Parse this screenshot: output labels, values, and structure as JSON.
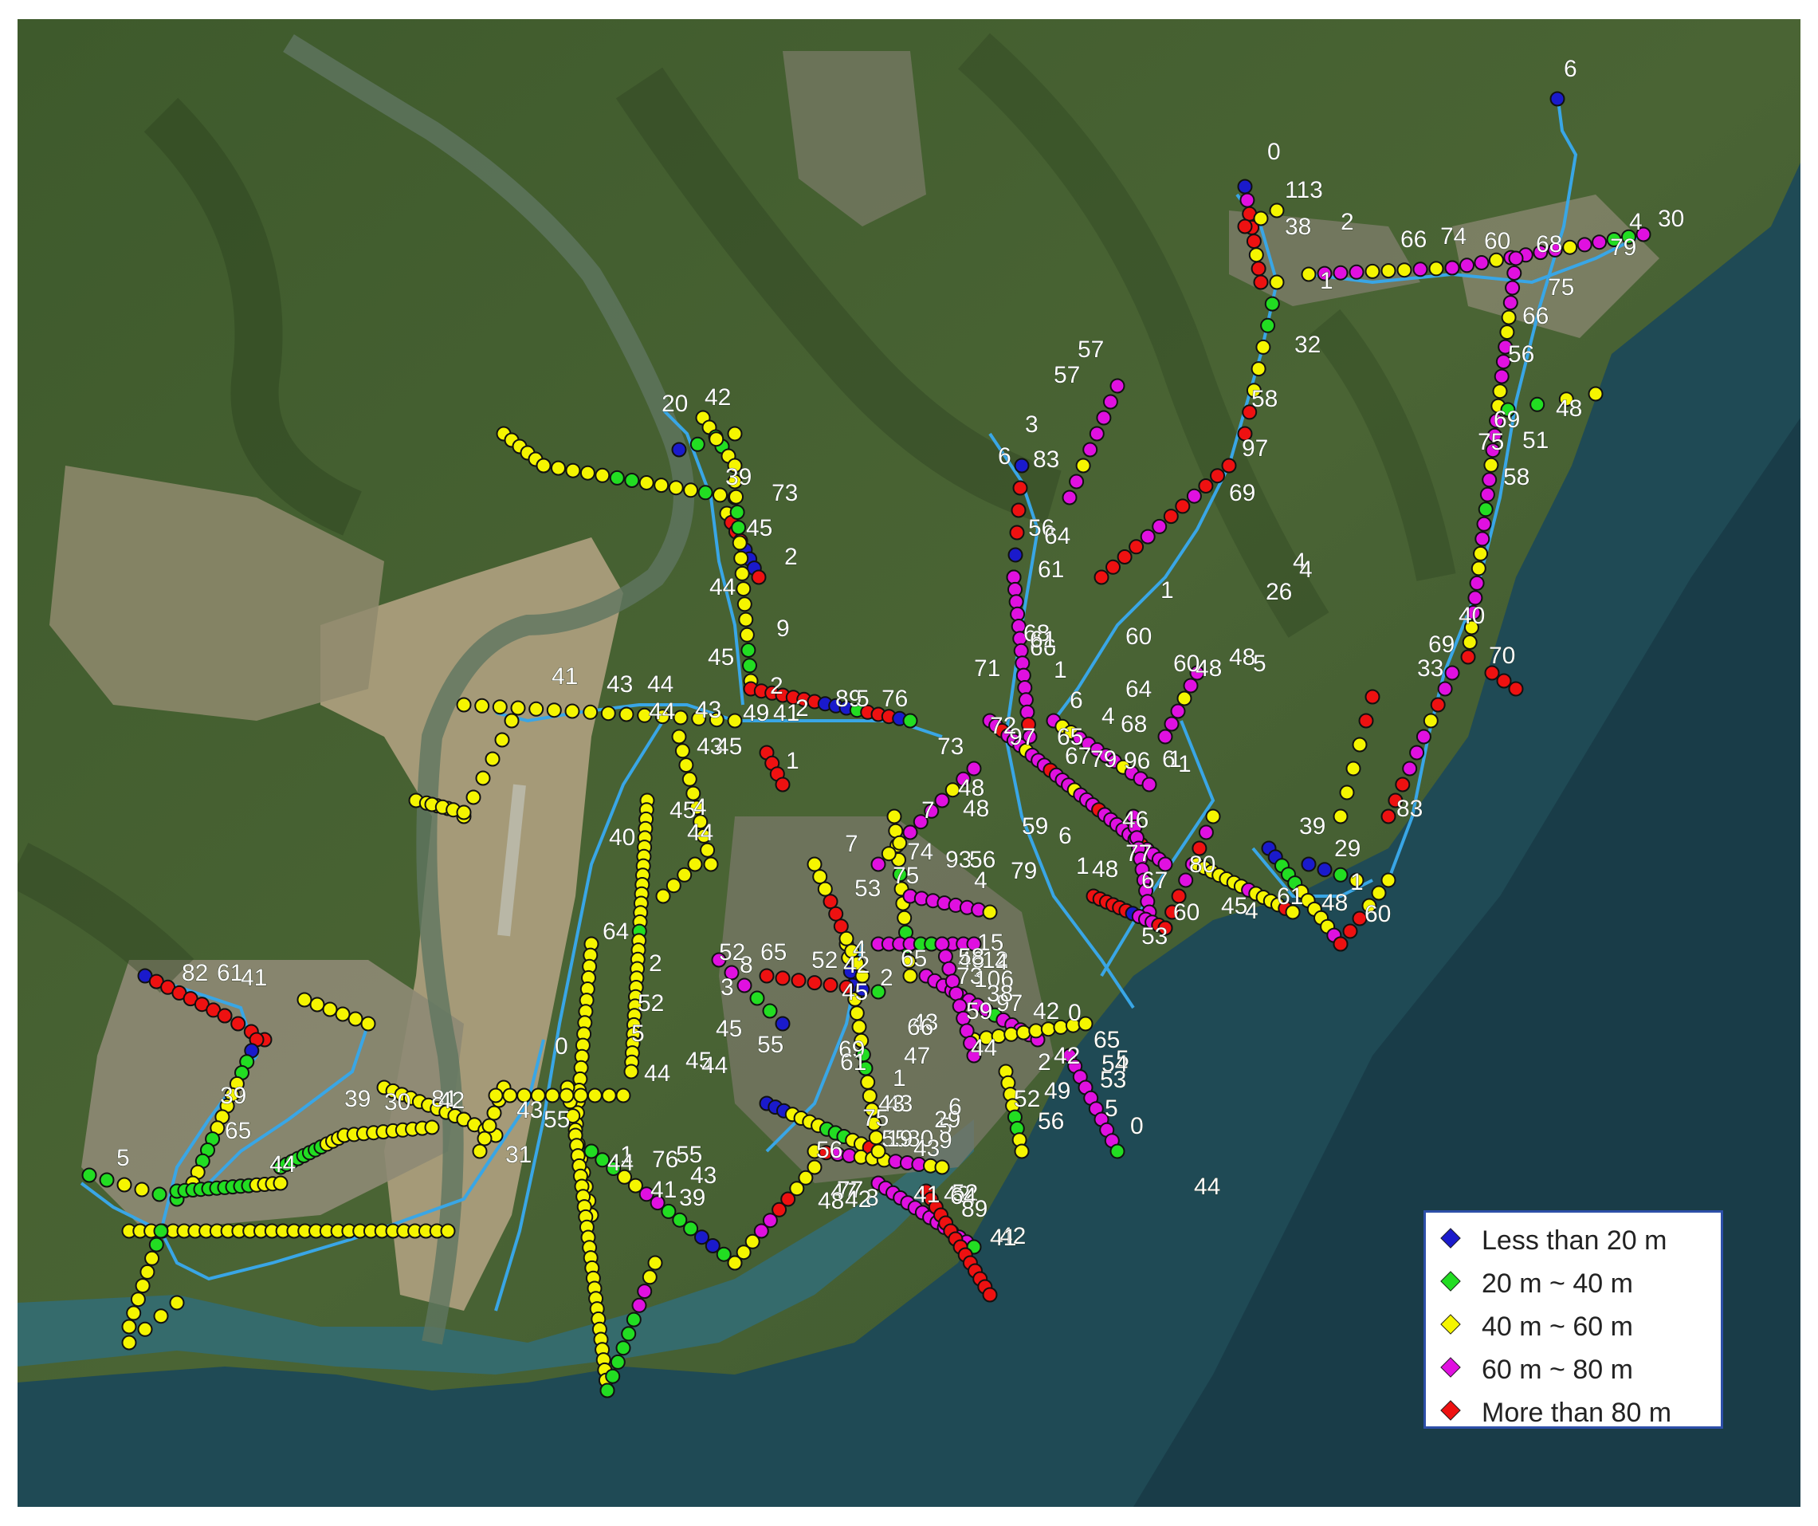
{
  "legend": {
    "items": [
      {
        "label": "Less than 20 m",
        "color": "#1a1acc"
      },
      {
        "label": "20 m ~ 40 m",
        "color": "#22dd22"
      },
      {
        "label": "40 m ~ 60 m",
        "color": "#f5f500"
      },
      {
        "label": "60 m ~ 80 m",
        "color": "#e010e0"
      },
      {
        "label": "More than 80 m",
        "color": "#ee1111"
      }
    ]
  },
  "colors": {
    "route_line": "#39a6e6",
    "label_text": "#ffffff",
    "marker_outline": "#111111"
  },
  "point_labels": [
    "6",
    "0",
    "113",
    "38",
    "2",
    "66",
    "74",
    "60",
    "68",
    "4",
    "30",
    "79",
    "1",
    "75",
    "66",
    "32",
    "56",
    "57",
    "57",
    "58",
    "48",
    "3",
    "69",
    "83",
    "6",
    "97",
    "75",
    "51",
    "58",
    "73",
    "69",
    "39",
    "20",
    "42",
    "45",
    "56",
    "4",
    "2",
    "64",
    "61",
    "66",
    "68",
    "48",
    "44",
    "4",
    "26",
    "1",
    "9",
    "69",
    "40",
    "45",
    "60",
    "61",
    "60",
    "48",
    "5",
    "71",
    "1",
    "33",
    "70",
    "41",
    "43",
    "44",
    "2",
    "64",
    "43",
    "89",
    "5",
    "6",
    "49",
    "41",
    "76",
    "2",
    "4",
    "68",
    "97",
    "65",
    "79",
    "6",
    "1",
    "72",
    "67",
    "96",
    "1",
    "44",
    "73",
    "48",
    "43",
    "45",
    "1",
    "48",
    "59",
    "45",
    "4",
    "7",
    "44",
    "46",
    "77",
    "83",
    "40",
    "74",
    "1",
    "6",
    "39",
    "29",
    "7",
    "93",
    "56",
    "79",
    "48",
    "67",
    "80",
    "75",
    "53",
    "4",
    "1",
    "61",
    "48",
    "60",
    "45",
    "64",
    "53",
    "60",
    "4",
    "8",
    "52",
    "65",
    "65",
    "46",
    "12",
    "15",
    "52",
    "42",
    "4",
    "2",
    "73",
    "2",
    "97",
    "4",
    "106",
    "45",
    "82",
    "61",
    "41",
    "3",
    "59",
    "38",
    "52",
    "45",
    "42",
    "0",
    "0",
    "58",
    "43",
    "65",
    "5",
    "69",
    "66",
    "45",
    "55",
    "42",
    "61",
    "47",
    "5",
    "44",
    "2",
    "5",
    "44",
    "54",
    "49",
    "44",
    "56",
    "39",
    "65",
    "53",
    "43",
    "52",
    "5",
    "1",
    "43",
    "39",
    "30",
    "81",
    "55",
    "43",
    "42",
    "5",
    "75",
    "29",
    "6",
    "0",
    "55",
    "80",
    "19",
    "56",
    "55",
    "44",
    "42",
    "52",
    "44",
    "8",
    "43",
    "64",
    "89",
    "41",
    "9",
    "31",
    "1",
    "76",
    "44",
    "43",
    "41",
    "47",
    "77",
    "42",
    "42",
    "48",
    "41",
    "39"
  ]
}
